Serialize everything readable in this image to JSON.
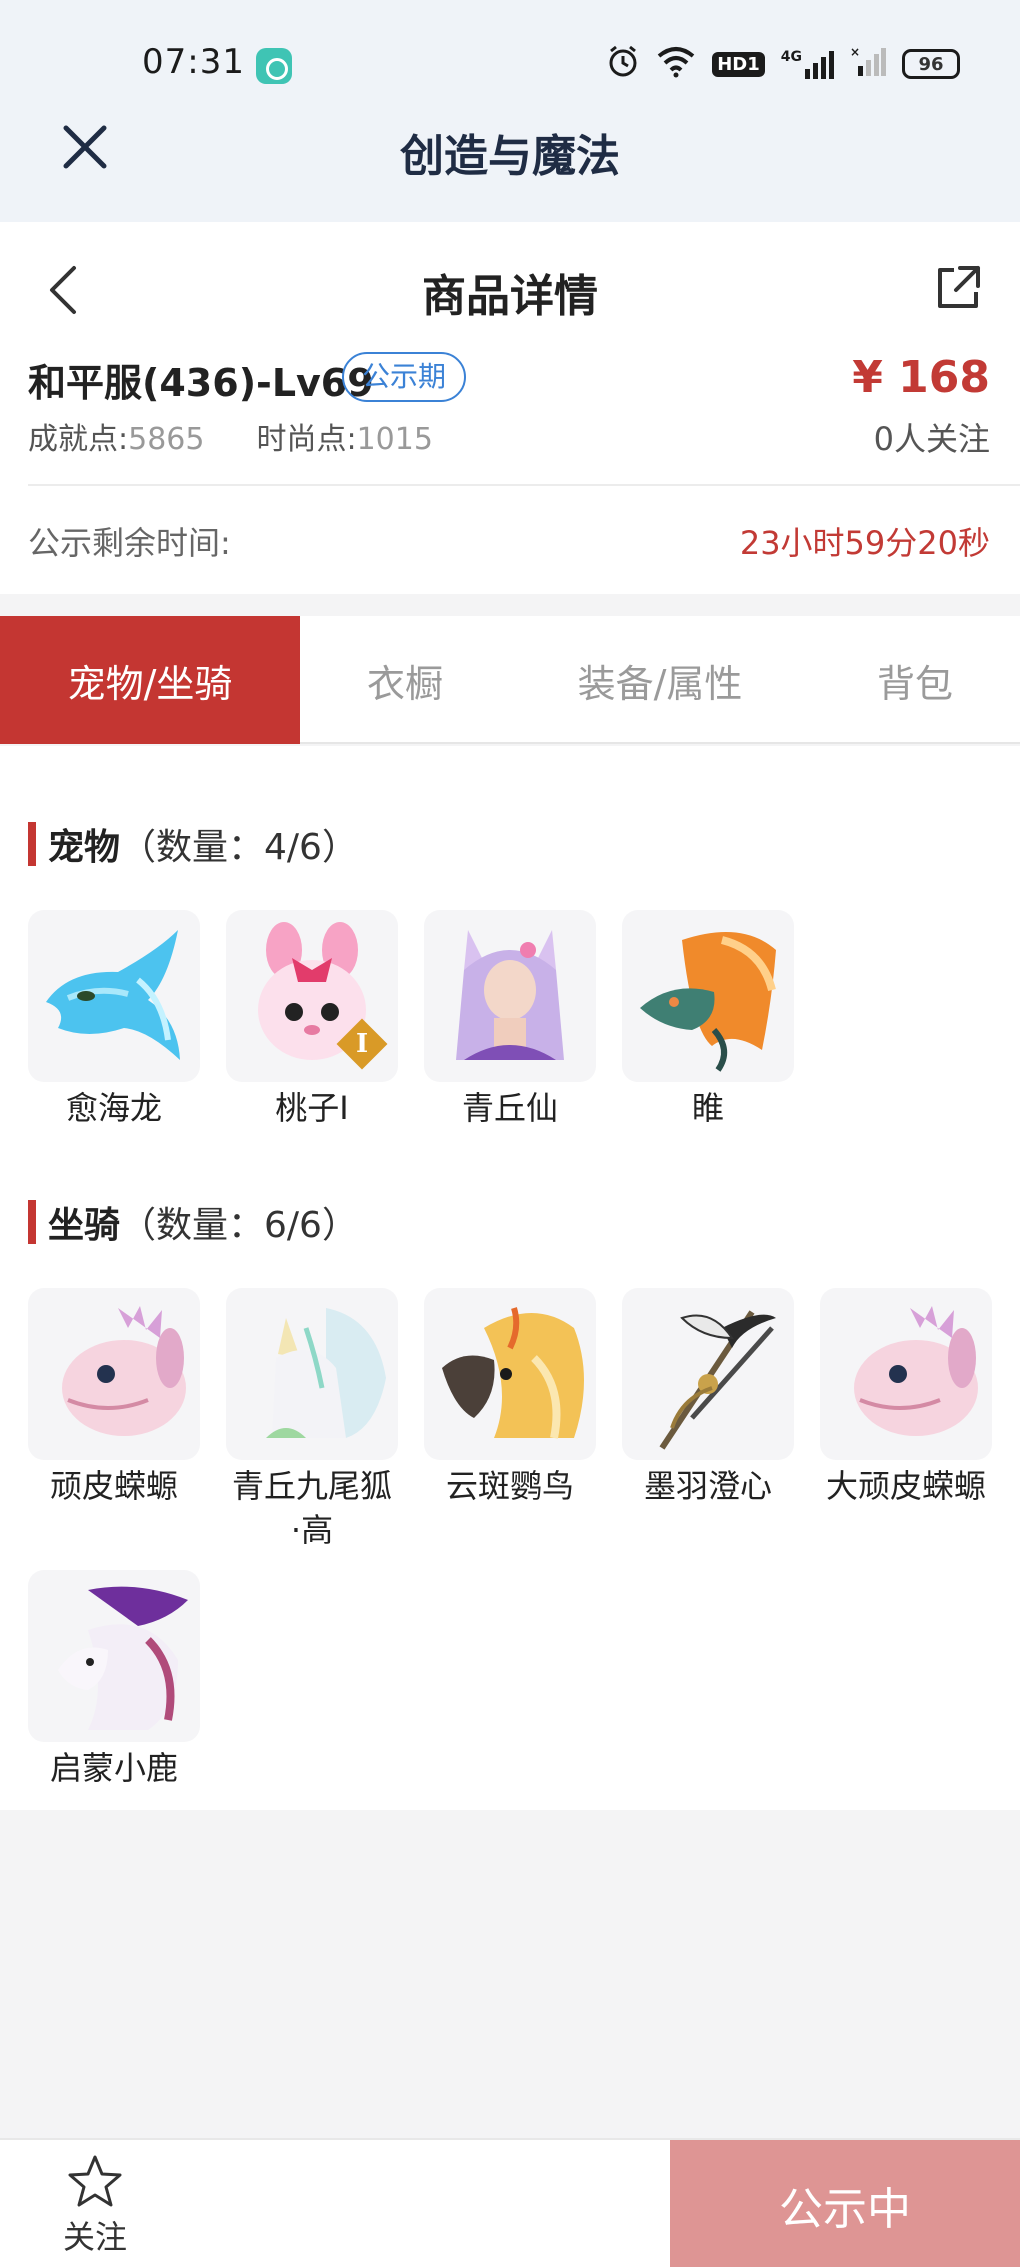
{
  "status_bar": {
    "time": "07:31",
    "wifi_icon": "wifi-icon",
    "hd_label": "HD1",
    "network_label": "4G",
    "battery": "96"
  },
  "app_bar": {
    "title": "创造与魔法"
  },
  "nav": {
    "title": "商品详情"
  },
  "product": {
    "name": "和平服(436)-Lv69",
    "badge": "公示期",
    "price": "¥ 168",
    "achievement_label": "成就点:",
    "achievement_value": "5865",
    "fashion_label": "时尚点:",
    "fashion_value": "1015",
    "followers": "0人关注"
  },
  "timer": {
    "label": "公示剩余时间:",
    "value": "23小时59分20秒"
  },
  "tabs": [
    {
      "label": "宠物/坐骑",
      "active": true
    },
    {
      "label": "衣橱",
      "active": false
    },
    {
      "label": "装备/属性",
      "active": false
    },
    {
      "label": "背包",
      "active": false
    }
  ],
  "pets": {
    "title": "宠物",
    "count": "（数量：4/6）",
    "items": [
      {
        "name": "愈海龙",
        "icon": "blue-sea-dragon-icon"
      },
      {
        "name": "桃子I",
        "icon": "pink-bunny-icon"
      },
      {
        "name": "青丘仙",
        "icon": "fox-fairy-icon"
      },
      {
        "name": "睢",
        "icon": "fire-dragon-icon"
      }
    ]
  },
  "mounts": {
    "title": "坐骑",
    "count": "（数量：6/6）",
    "items": [
      {
        "name": "顽皮蝾螈",
        "icon": "pink-axolotl-icon"
      },
      {
        "name": "青丘九尾狐·高",
        "line1": "青丘九尾狐",
        "line2": "·高",
        "icon": "nine-tail-fox-icon"
      },
      {
        "name": "云斑鹦鸟",
        "icon": "parrot-icon"
      },
      {
        "name": "墨羽澄心",
        "icon": "feather-staff-icon"
      },
      {
        "name": "大顽皮蝾螈",
        "icon": "pink-axolotl-icon"
      },
      {
        "name": "启蒙小鹿",
        "icon": "purple-deer-icon"
      }
    ]
  },
  "bottom": {
    "follow_label": "关注",
    "status_label": "公示中"
  },
  "colors": {
    "accent": "#c43632",
    "price": "#c23a35",
    "badge": "#3b82d6",
    "status_button": "#de9594"
  }
}
